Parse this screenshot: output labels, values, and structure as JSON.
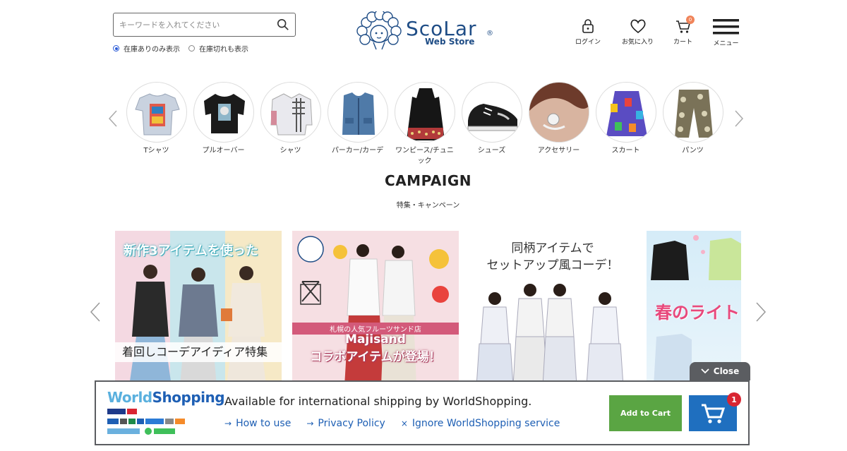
{
  "search": {
    "placeholder": "キーワードを入れてください"
  },
  "stock_filter": {
    "options": [
      "在庫ありのみ表示",
      "在庫切れも表示"
    ],
    "selected": 0
  },
  "logo": {
    "brand": "ScoLar",
    "sub": "Web Store"
  },
  "header_nav": {
    "login": "ログイン",
    "favorites": "お気に入り",
    "cart": "カート",
    "cart_count": "0",
    "menu": "メニュー"
  },
  "categories": [
    {
      "label": "Tシャツ"
    },
    {
      "label": "プルオーバー"
    },
    {
      "label": "シャツ"
    },
    {
      "label": "パーカー/カーデ"
    },
    {
      "label": "ワンピース/チュニック"
    },
    {
      "label": "シューズ"
    },
    {
      "label": "アクセサリー"
    },
    {
      "label": "スカート"
    },
    {
      "label": "パンツ"
    }
  ],
  "campaign": {
    "title": "CAMPAIGN",
    "subtitle": "特集・キャンペーン"
  },
  "banners": [
    {
      "head": "新作3アイテムを使った",
      "foot": "着回しコーデアイディア特集"
    },
    {
      "line1": "札幌の人気フルーツサンド店",
      "line2": "Majisand",
      "line3": "コラボアイテムが登場！"
    },
    {
      "line1": "同柄アイテムで",
      "line2": "セットアップ風コーデ！"
    },
    {
      "line1": "春のライト"
    }
  ],
  "worldshopping": {
    "close": "Close",
    "logo_a": "World",
    "logo_b": "Shopping",
    "message": "Available for international shipping by WorldShopping.",
    "how_to": "How to use",
    "privacy": "Privacy Policy",
    "ignore": "Ignore WorldShopping service",
    "add_to_cart": "Add to Cart",
    "cart_count": "1"
  },
  "colors": {
    "accent": "#1f4d86",
    "ws_green": "#5aa543",
    "ws_blue": "#1f6fbf",
    "badge": "#f0845a"
  }
}
